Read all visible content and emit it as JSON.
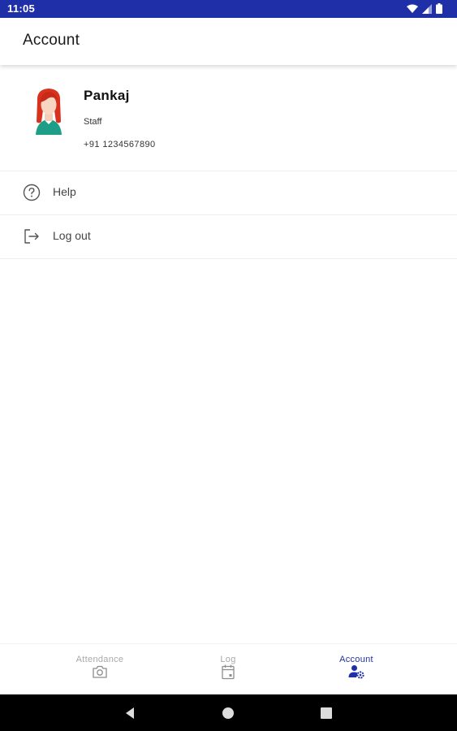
{
  "status_bar": {
    "time": "11:05",
    "icons": [
      "wifi-icon",
      "signal-icon",
      "battery-icon"
    ]
  },
  "app_bar": {
    "title": "Account"
  },
  "profile": {
    "name": "Pankaj",
    "role": "Staff",
    "phone": "+91 1234567890",
    "avatar_icon": "female-avatar-icon"
  },
  "menu": {
    "items": [
      {
        "label": "Help",
        "icon": "help-circle-icon"
      },
      {
        "label": "Log out",
        "icon": "logout-icon"
      }
    ]
  },
  "bottom_nav": {
    "items": [
      {
        "label": "Attendance",
        "icon": "camera-icon",
        "active": false
      },
      {
        "label": "Log",
        "icon": "calendar-icon",
        "active": false
      },
      {
        "label": "Account",
        "icon": "account-settings-icon",
        "active": true
      }
    ]
  },
  "system_nav": {
    "buttons": [
      "back-icon",
      "home-icon",
      "recents-icon"
    ]
  },
  "colors": {
    "primary": "#1f2fa8",
    "inactive": "#a8a8a8",
    "divider": "#eeeeee",
    "avatar_hair": "#d8321f",
    "avatar_shirt": "#1e9e86"
  }
}
